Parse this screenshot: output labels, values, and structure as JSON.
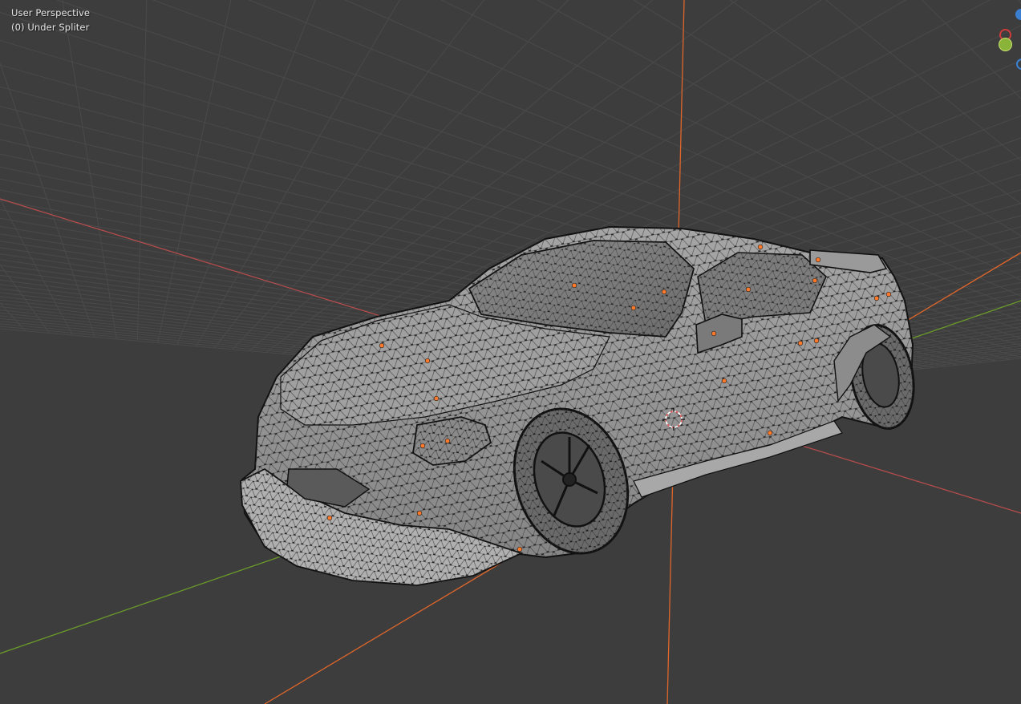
{
  "viewport": {
    "view_label": "User Perspective",
    "object_label": "(0) Under Spliter"
  },
  "colors": {
    "background": "#3d3d3d",
    "grid_line": "#4a4a4a",
    "x_axis": "#b34c4c",
    "y_axis": "#6a9a2a",
    "z_axis": "#e0662a",
    "mesh_face": "#9a9a9a",
    "mesh_vertex": "#111111",
    "selected_vertex": "#ff7a2a",
    "gizmo_x": "#d13b3b",
    "gizmo_y": "#8ab33a",
    "gizmo_z": "#3a7fd1"
  },
  "icons": {
    "origin": "3d-cursor-icon",
    "gizmo_x": "gizmo-x-axis-icon",
    "gizmo_y": "gizmo-y-axis-icon",
    "gizmo_z": "gizmo-z-axis-icon"
  }
}
